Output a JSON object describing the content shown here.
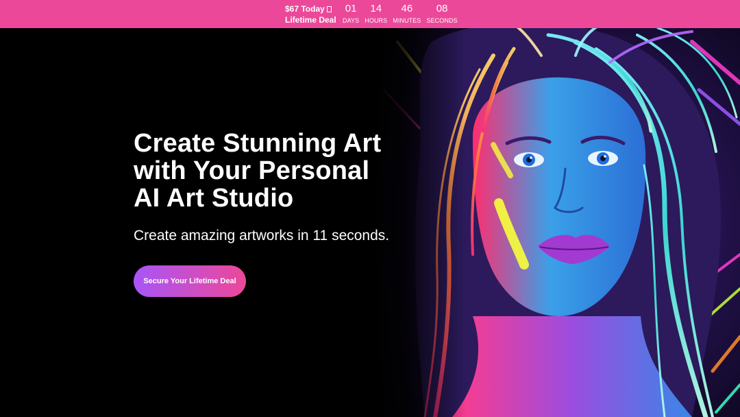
{
  "promo": {
    "price_line": "$67 Today",
    "deal_line": "Lifetime Deal",
    "icon": "alarm-clock-icon",
    "countdown": [
      {
        "value": "01",
        "label": "DAYS"
      },
      {
        "value": "14",
        "label": "HOURS"
      },
      {
        "value": "46",
        "label": "MINUTES"
      },
      {
        "value": "08",
        "label": "SECONDS"
      }
    ]
  },
  "hero": {
    "title_lines": [
      "Create Stunning Art",
      "with Your Personal",
      "AI Art Studio"
    ],
    "subtitle": "Create amazing artworks in 11 seconds.",
    "cta_label": "Secure Your Lifetime Deal",
    "image_subject": "neon-portrait-woman"
  },
  "colors": {
    "promo_bar": "#ec4899",
    "background": "#000000",
    "cta_gradient_start": "#a855f7",
    "cta_gradient_end": "#ec4899"
  }
}
